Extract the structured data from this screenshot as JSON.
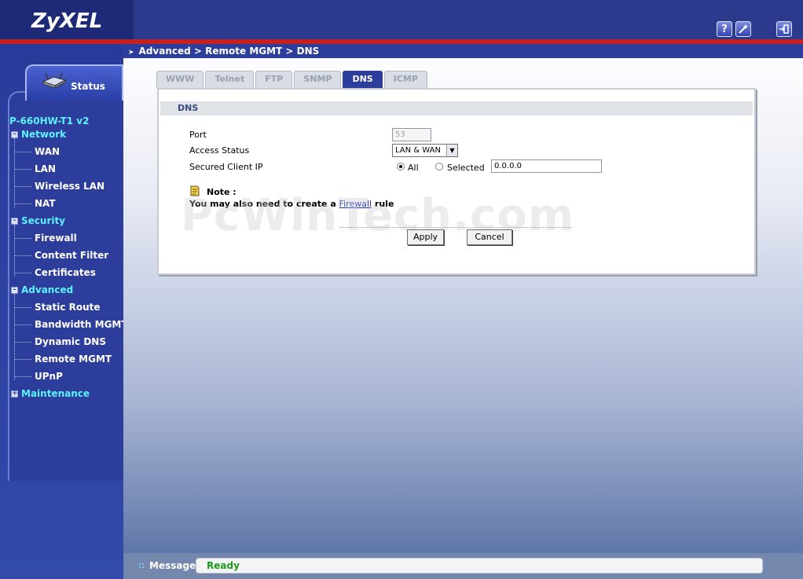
{
  "header": {
    "logo": "ZyXEL",
    "help_icon": "question-icon",
    "wizard_icon": "wand-icon",
    "logout_icon": "logout-icon"
  },
  "breadcrumb": "Advanced > Remote MGMT > DNS",
  "sidebar": {
    "status_label": "Status",
    "device": "P-660HW-T1 v2",
    "sections": [
      {
        "label": "Network",
        "expand": "-",
        "items": [
          "WAN",
          "LAN",
          "Wireless LAN",
          "NAT"
        ]
      },
      {
        "label": "Security",
        "expand": "-",
        "items": [
          "Firewall",
          "Content Filter",
          "Certificates"
        ]
      },
      {
        "label": "Advanced",
        "expand": "-",
        "items": [
          "Static Route",
          "Bandwidth MGMT",
          "Dynamic DNS",
          "Remote MGMT",
          "UPnP"
        ]
      },
      {
        "label": "Maintenance",
        "expand": "+",
        "items": []
      }
    ]
  },
  "tabs": [
    {
      "label": "WWW",
      "active": false
    },
    {
      "label": "Telnet",
      "active": false
    },
    {
      "label": "FTP",
      "active": false
    },
    {
      "label": "SNMP",
      "active": false
    },
    {
      "label": "DNS",
      "active": true
    },
    {
      "label": "ICMP",
      "active": false
    }
  ],
  "form": {
    "section_title": "DNS",
    "port_label": "Port",
    "port_value": "53",
    "access_label": "Access Status",
    "access_value": "LAN & WAN",
    "secured_label": "Secured Client IP",
    "radio_all": "All",
    "radio_selected": "Selected",
    "ip_value": "0.0.0.0",
    "selected_option": "All"
  },
  "note": {
    "title": "Note :",
    "text_before": "You may also need to create a",
    "link": "Firewall",
    "text_after": "rule"
  },
  "watermark": "PcWinTech.com",
  "buttons": {
    "apply": "Apply",
    "cancel": "Cancel"
  },
  "footer": {
    "label": "Message",
    "status": "Ready"
  }
}
